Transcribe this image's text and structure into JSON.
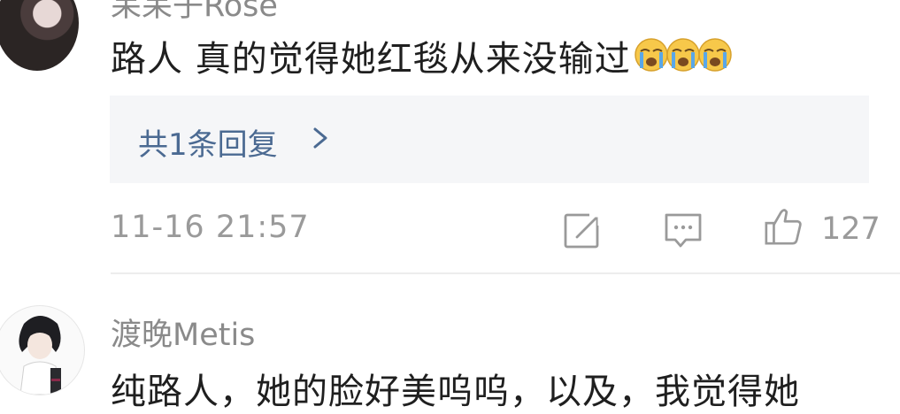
{
  "comments": [
    {
      "username": "呆呆子Rose",
      "text": "路人 真的觉得她红毯从来没输过",
      "emojis": [
        "loudly-crying-face",
        "loudly-crying-face",
        "loudly-crying-face"
      ],
      "reply_link": "共1条回复",
      "timestamp": "11-16 21:57",
      "likes": "127"
    },
    {
      "username": "渡晚Metis",
      "text": "纯路人，她的脸好美呜呜，以及，我觉得她"
    }
  ],
  "icons": {
    "share": "share-edit-icon",
    "comment": "comment-bubble-icon",
    "like": "thumbs-up-icon",
    "chevron": "chevron-right-icon"
  },
  "colors": {
    "link": "#4b6a92",
    "meta": "#9a9a9a",
    "reply_bg": "#f5f6f8"
  }
}
